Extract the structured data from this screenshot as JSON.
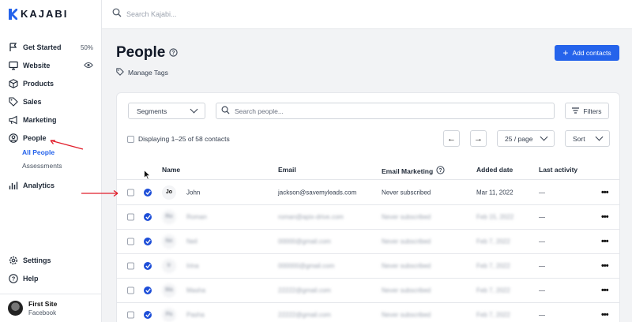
{
  "brand": {
    "name": "KAJABI",
    "color": "#2563eb"
  },
  "search": {
    "placeholder": "Search Kajabi..."
  },
  "sidebar": {
    "items": [
      {
        "label": "Get Started",
        "icon": "flag-icon",
        "right": "50%"
      },
      {
        "label": "Website",
        "icon": "monitor-icon",
        "right_icon": "eye-icon"
      },
      {
        "label": "Products",
        "icon": "box-icon"
      },
      {
        "label": "Sales",
        "icon": "tag-icon"
      },
      {
        "label": "Marketing",
        "icon": "megaphone-icon"
      },
      {
        "label": "People",
        "icon": "user-circle-icon"
      },
      {
        "label": "Analytics",
        "icon": "bar-chart-icon"
      }
    ],
    "people_sub": [
      "All People",
      "Assessments"
    ],
    "bottom": [
      {
        "label": "Settings",
        "icon": "gear-icon"
      },
      {
        "label": "Help",
        "icon": "help-circle-icon"
      }
    ],
    "profile": {
      "name": "First Site",
      "sub": "Facebook"
    }
  },
  "main": {
    "title": "People",
    "manage_tags": "Manage Tags",
    "add_contacts": "Add contacts",
    "segments": "Segments",
    "search_people": "Search people...",
    "filters": "Filters",
    "displaying": "Displaying 1–25 of 58 contacts",
    "per_page": "25 / page",
    "sort": "Sort"
  },
  "table": {
    "headers": [
      "Name",
      "Email",
      "Email Marketing",
      "Added date",
      "Last activity"
    ],
    "rows": [
      {
        "initials": "Jo",
        "name": "John",
        "email": "jackson@savemyleads.com",
        "marketing": "Never subscribed",
        "added": "Mar 11, 2022",
        "activity": "—",
        "blur": false
      },
      {
        "initials": "Ro",
        "name": "Roman",
        "email": "roman@apix-drive.com",
        "marketing": "Never subscribed",
        "added": "Feb 15, 2022",
        "activity": "—",
        "blur": true
      },
      {
        "initials": "Ne",
        "name": "Neil",
        "email": "00000@gmail.com",
        "marketing": "Never subscribed",
        "added": "Feb 7, 2022",
        "activity": "—",
        "blur": true
      },
      {
        "initials": "Ir",
        "name": "Irina",
        "email": "000000@gmail.com",
        "marketing": "Never subscribed",
        "added": "Feb 7, 2022",
        "activity": "—",
        "blur": true
      },
      {
        "initials": "Ma",
        "name": "Masha",
        "email": "22222@gmail.com",
        "marketing": "Never subscribed",
        "added": "Feb 7, 2022",
        "activity": "—",
        "blur": true
      },
      {
        "initials": "Pa",
        "name": "Pasha",
        "email": "22222@gmail.com",
        "marketing": "Never subscribed",
        "added": "Feb 7, 2022",
        "activity": "—",
        "blur": true
      }
    ]
  }
}
